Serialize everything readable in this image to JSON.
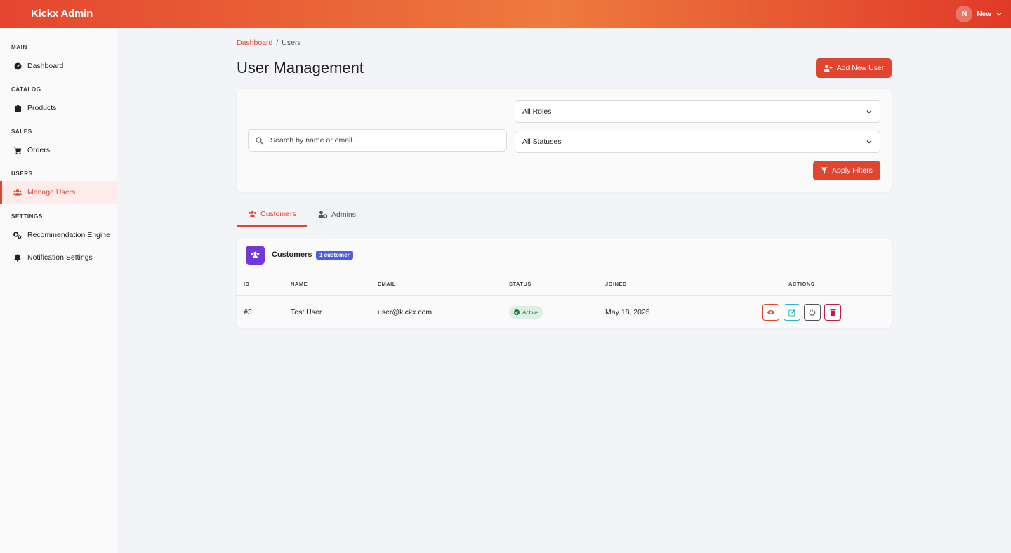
{
  "app": {
    "brand": "Kickx Admin"
  },
  "user_menu": {
    "avatar_initial": "N",
    "name": "New"
  },
  "sidebar": {
    "sections": [
      {
        "title": "MAIN",
        "items": [
          {
            "label": "Dashboard",
            "icon": "dashboard-icon"
          }
        ]
      },
      {
        "title": "CATALOG",
        "items": [
          {
            "label": "Products",
            "icon": "box-icon"
          }
        ]
      },
      {
        "title": "SALES",
        "items": [
          {
            "label": "Orders",
            "icon": "cart-icon"
          }
        ]
      },
      {
        "title": "USERS",
        "items": [
          {
            "label": "Manage Users",
            "icon": "users-icon",
            "active": true
          }
        ]
      },
      {
        "title": "SETTINGS",
        "items": [
          {
            "label": "Recommendation Engine",
            "icon": "cogs-icon"
          },
          {
            "label": "Notification Settings",
            "icon": "bell-icon"
          }
        ]
      }
    ]
  },
  "breadcrumb": {
    "link": "Dashboard",
    "separator": "/",
    "current": "Users"
  },
  "page": {
    "title": "User Management",
    "add_button": "Add New User"
  },
  "filters": {
    "search_placeholder": "Search by name or email...",
    "role_select": "All Roles",
    "status_select": "All Statuses",
    "apply_button": "Apply Filters"
  },
  "tabs": [
    {
      "label": "Customers",
      "active": true
    },
    {
      "label": "Admins",
      "active": false
    }
  ],
  "table": {
    "title": "Customers",
    "badge": "1 customer",
    "columns": [
      "ID",
      "NAME",
      "EMAIL",
      "STATUS",
      "JOINED",
      "ACTIONS"
    ],
    "rows": [
      {
        "id": "#3",
        "name": "Test User",
        "email": "user@kickx.com",
        "status": "Active",
        "joined": "May 18, 2025"
      }
    ]
  },
  "colors": {
    "accent": "#e2452f",
    "purple": "#6f3bd6",
    "badge_blue": "#4e5de8",
    "status_green": "#1e7a3c"
  }
}
